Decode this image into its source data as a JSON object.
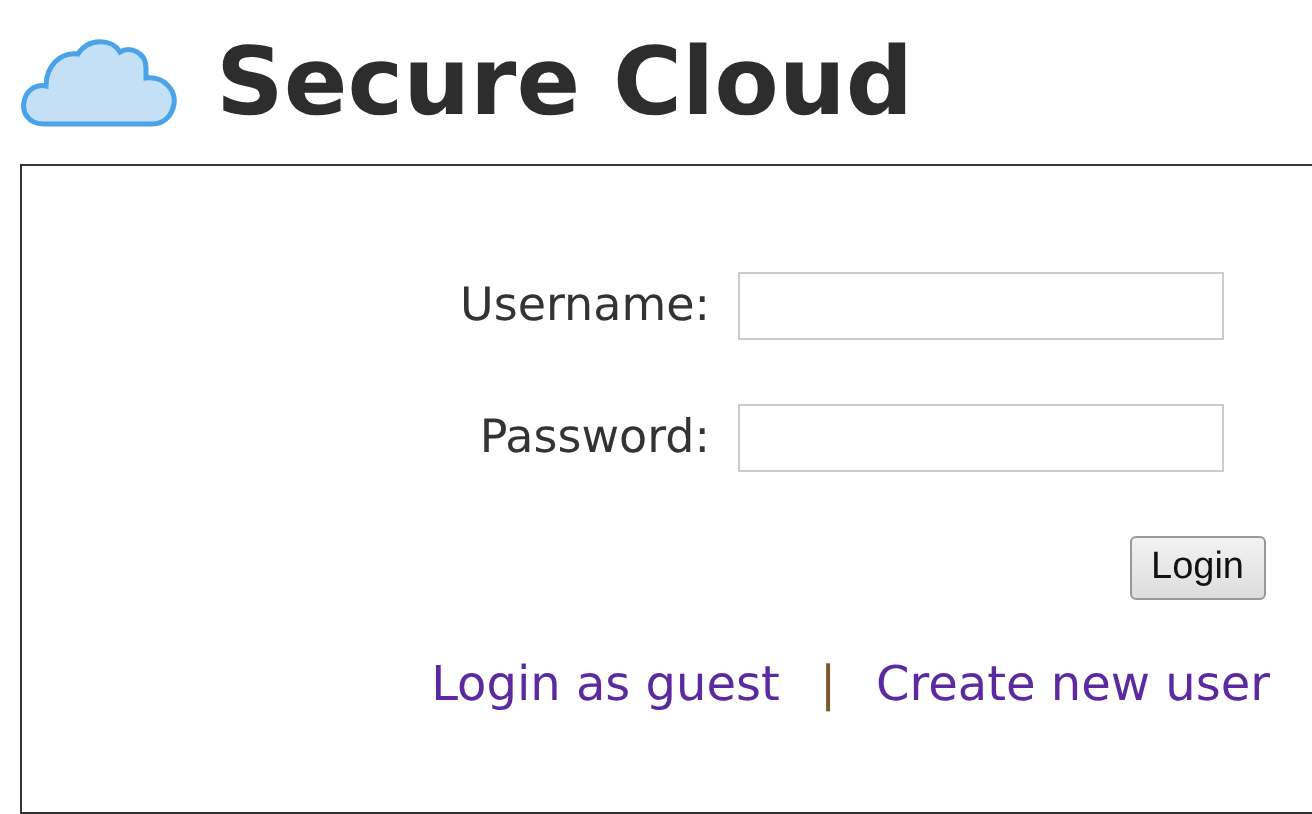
{
  "header": {
    "title": "Secure Cloud"
  },
  "form": {
    "fields": [
      {
        "label": "Username:"
      },
      {
        "label": "Password:"
      }
    ],
    "button": "Login"
  },
  "links": [
    {
      "label": "Login as guest"
    },
    {
      "label": "Create new user"
    }
  ],
  "separator": "|"
}
